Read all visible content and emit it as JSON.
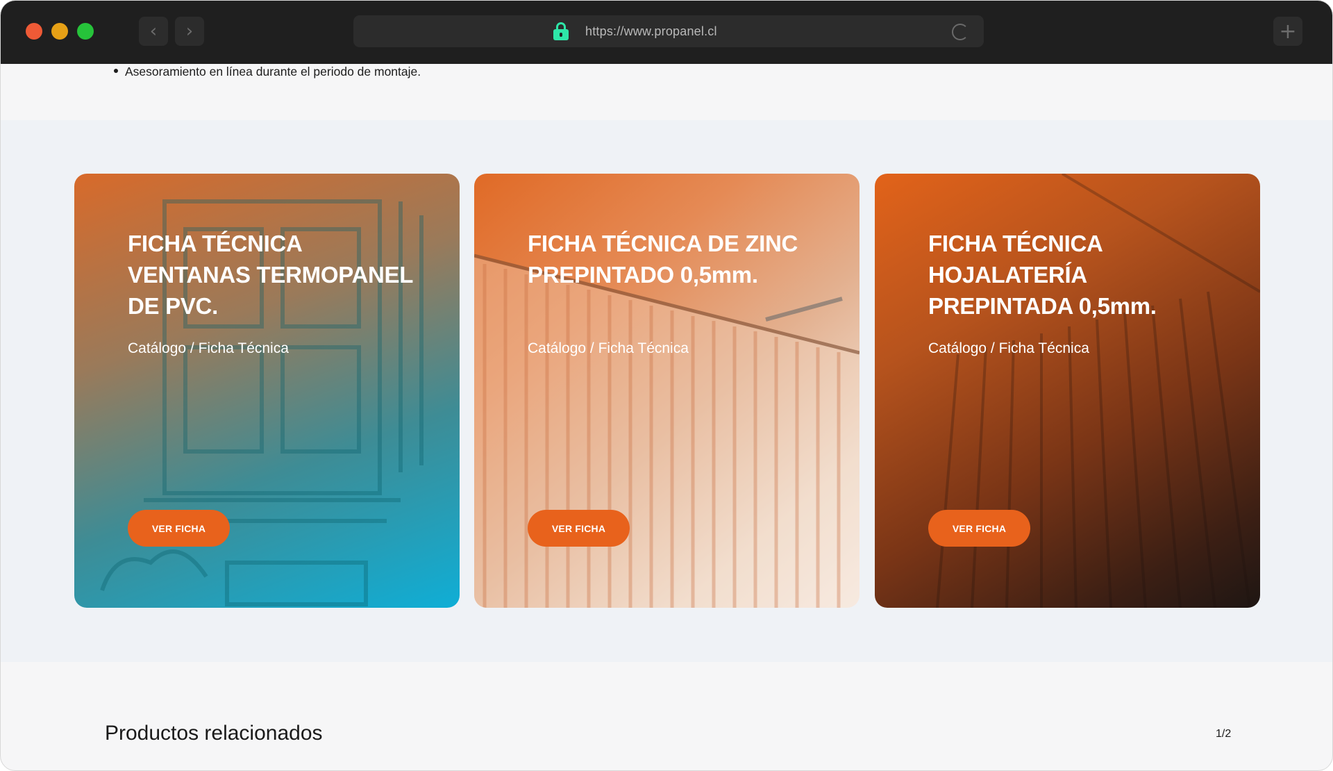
{
  "browser": {
    "url": "https://www.propanel.cl",
    "back_icon": "‹",
    "forward_icon": "›",
    "new_tab_icon": "+"
  },
  "content": {
    "bullet": "Asesoramiento en línea durante el periodo de montaje."
  },
  "cards": [
    {
      "title": "FICHA TÉCNICA VENTANAS TERMOPANEL DE PVC.",
      "subtitle": "Catálogo / Ficha Técnica",
      "button": "VER FICHA"
    },
    {
      "title": "FICHA TÉCNICA DE ZINC PREPINTADO 0,5mm.",
      "subtitle": "Catálogo / Ficha Técnica",
      "button": "VER FICHA"
    },
    {
      "title": "FICHA TÉCNICA HOJALATERÍA PREPINTADA 0,5mm.",
      "subtitle": "Catálogo / Ficha Técnica",
      "button": "VER FICHA"
    }
  ],
  "related": {
    "title": "Productos relacionados",
    "pager": "1/2"
  },
  "colors": {
    "accent": "#e8621c",
    "chrome": "#1f1f1f",
    "lock": "#2ee6a8",
    "band": "#eff2f6"
  }
}
